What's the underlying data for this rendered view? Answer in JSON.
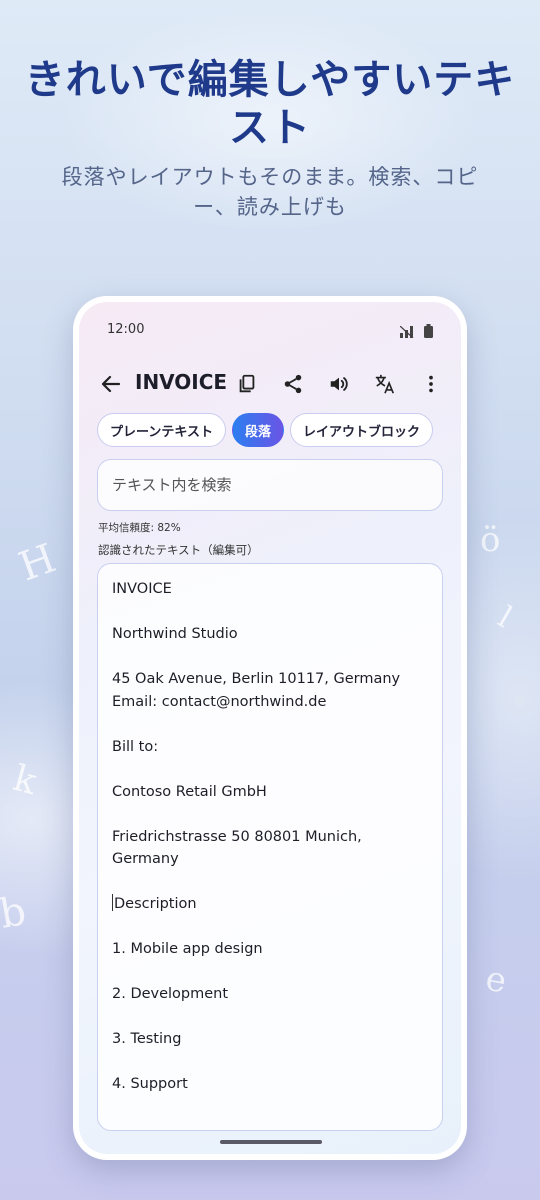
{
  "headline": "きれいで編集しやすいテキスト",
  "subheadline": "段落やレイアウトもそのまま。検索、コピー、読み上げも",
  "phone": {
    "status_time": "12:00",
    "app_title": "INVOICE",
    "toolbar_icons": [
      "back-arrow-icon",
      "copy-icon",
      "share-icon",
      "volume-icon",
      "translate-icon",
      "more-vert-icon"
    ],
    "view_modes": [
      {
        "label": "プレーンテキスト",
        "selected": false
      },
      {
        "label": "段落",
        "selected": true
      },
      {
        "label": "レイアウトブロック",
        "selected": false
      }
    ],
    "search_placeholder": "テキスト内を検索",
    "confidence": "平均信頼度: 82%",
    "section_label": "認識されたテキスト（編集可）",
    "text_lines": [
      "INVOICE",
      "",
      "Northwind Studio",
      "",
      "45 Oak Avenue, Berlin 10117, Germany",
      "Email: contact@northwind.de",
      "",
      "Bill to:",
      "",
      "Contoso Retail GmbH",
      "",
      "Friedrichstrasse 50 80801 Munich,",
      "Germany",
      "",
      "Description",
      "",
      "1. Mobile app design",
      "",
      "2. Development",
      "",
      "3. Testing",
      "",
      "4. Support"
    ],
    "accent_color": "#2d7ef0"
  }
}
